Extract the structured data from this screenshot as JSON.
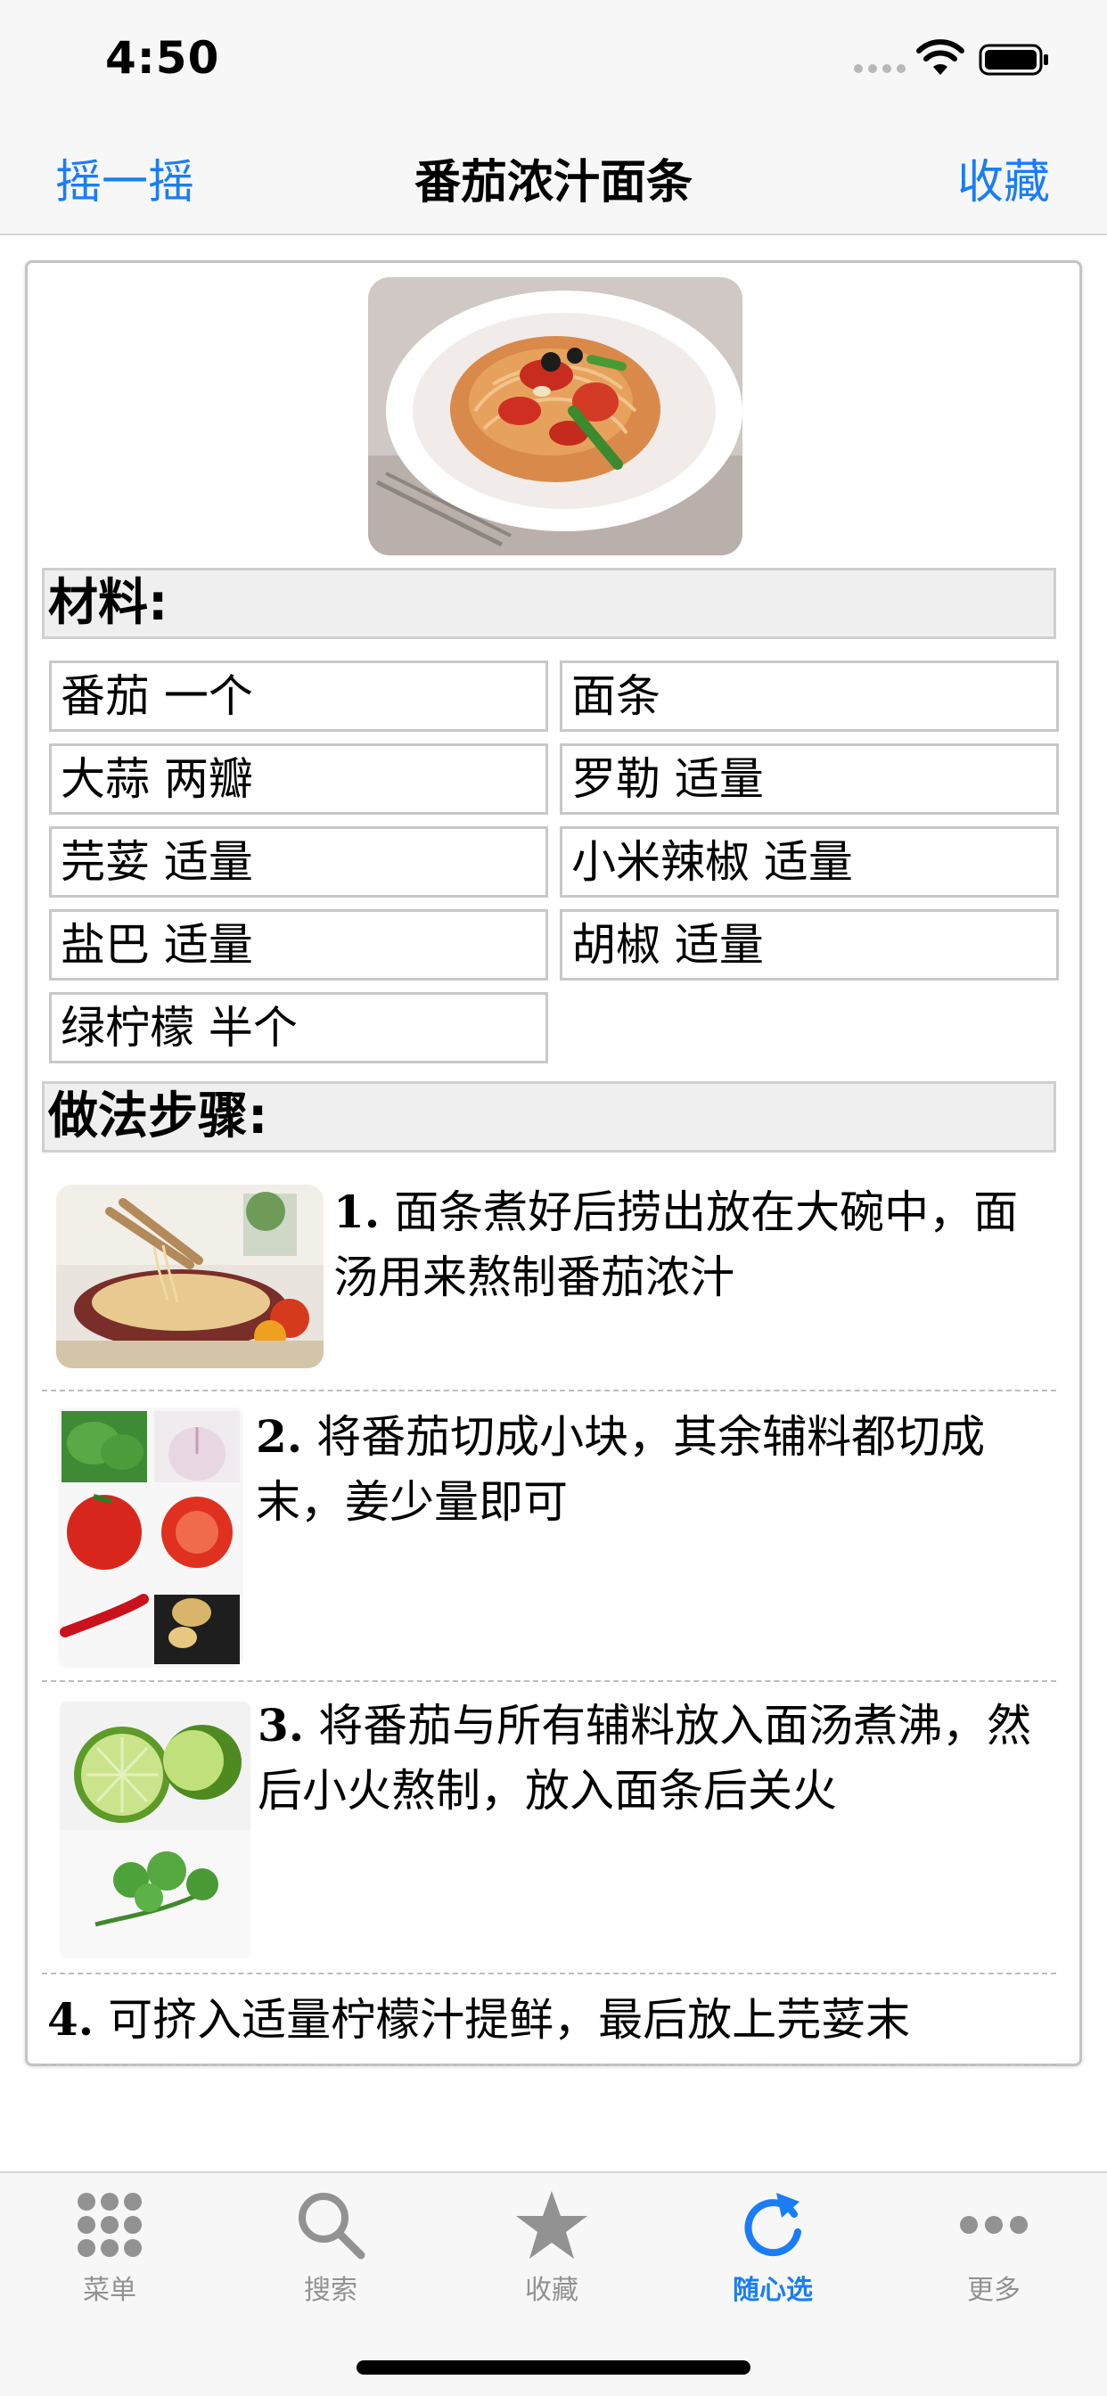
{
  "status_bar": {
    "time": "4:50"
  },
  "nav": {
    "left_label": "摇一摇",
    "title": "番茄浓汁面条",
    "right_label": "收藏"
  },
  "materials": {
    "header": "材料:",
    "items": [
      "番茄 一个",
      "面条",
      "大蒜 两瓣",
      "罗勒 适量",
      "芫荽 适量",
      "小米辣椒 适量",
      "盐巴 适量",
      "胡椒 适量",
      "绿柠檬 半个"
    ]
  },
  "steps": {
    "header": "做法步骤:",
    "items": [
      {
        "num": "1.",
        "text": " 面条煮好后捞出放在大碗中，面汤用来熬制番茄浓汁"
      },
      {
        "num": "2.",
        "text": " 将番茄切成小块，其余辅料都切成末，姜少量即可"
      },
      {
        "num": "3.",
        "text": " 将番茄与所有辅料放入面汤煮沸，然后小火熬制，放入面条后关火"
      },
      {
        "num": "4.",
        "text": " 可挤入适量柠檬汁提鲜，最后放上芫荽末"
      }
    ]
  },
  "tab_bar": {
    "tabs": [
      {
        "label": "菜单",
        "icon": "grid-icon"
      },
      {
        "label": "搜索",
        "icon": "search-icon"
      },
      {
        "label": "收藏",
        "icon": "star-icon"
      },
      {
        "label": "随心选",
        "icon": "refresh-icon"
      },
      {
        "label": "更多",
        "icon": "more-icon"
      }
    ],
    "active_index": 3
  },
  "colors": {
    "accent": "#1a7df5",
    "tab_inactive": "#929292"
  }
}
